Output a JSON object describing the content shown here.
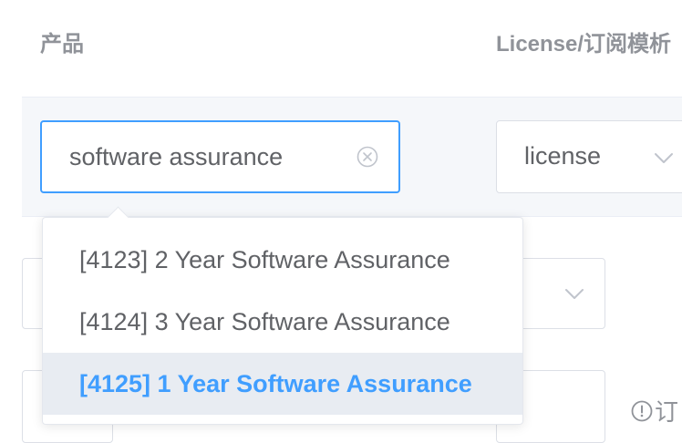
{
  "table": {
    "headers": {
      "product": "产品",
      "license_template": "License/订阅模析"
    }
  },
  "row1": {
    "product_input": {
      "value": "software assurance"
    },
    "license_select": {
      "value": "license"
    }
  },
  "dropdown": {
    "options": [
      {
        "label": "[4123] 2 Year Software Assurance"
      },
      {
        "label": "[4124] 3 Year Software Assurance"
      },
      {
        "label": "[4125] 1 Year Software Assurance",
        "selected": true
      }
    ]
  },
  "footer_hint": {
    "text": "订"
  },
  "icons": {
    "clear": "circle-x-icon",
    "select_arrow": "chevron-down-icon",
    "info": "exclamation-circle-icon"
  },
  "colors": {
    "accent": "#409eff",
    "selected_bg": "#e8ecf2",
    "row_bg": "#f5f7fa",
    "header_text": "#909399"
  }
}
